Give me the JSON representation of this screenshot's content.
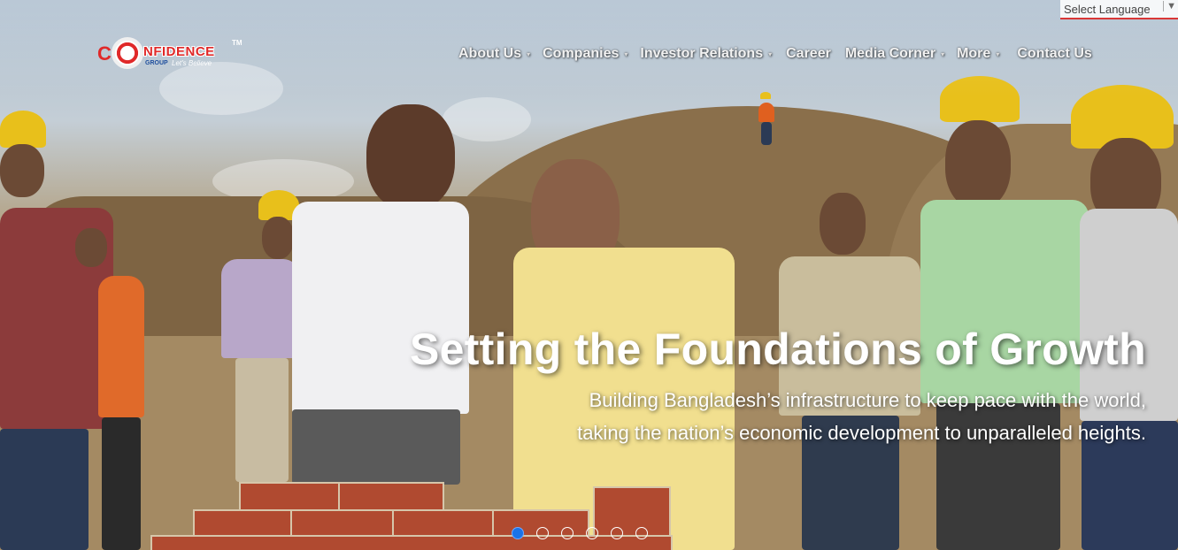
{
  "language_selector": {
    "label": "Select Language",
    "arrow": "▼"
  },
  "logo": {
    "letter": "C",
    "word": "NFIDENCE",
    "trademark": "TM",
    "group": "GROUP",
    "tagline": "Let's Believe"
  },
  "nav": {
    "items": [
      {
        "label": "About Us",
        "has_dropdown": true
      },
      {
        "label": "Companies",
        "has_dropdown": true
      },
      {
        "label": "Investor Relations",
        "has_dropdown": true
      },
      {
        "label": "Career",
        "has_dropdown": false
      },
      {
        "label": "Media Corner",
        "has_dropdown": true
      },
      {
        "label": "More",
        "has_dropdown": true
      },
      {
        "label": "Contact Us",
        "has_dropdown": false
      }
    ],
    "caret": "▾"
  },
  "hero": {
    "headline": "Setting the Foundations of Growth",
    "subline_1": "Building Bangladesh’s infrastructure to keep pace with the world,",
    "subline_2": "taking the nation’s economic development to unparalleled heights."
  },
  "carousel": {
    "slide_count": 6,
    "active_index": 0
  },
  "colors": {
    "brand_red": "#e02929",
    "active_dot": "#1a73e8",
    "language_underline": "#d93636"
  }
}
